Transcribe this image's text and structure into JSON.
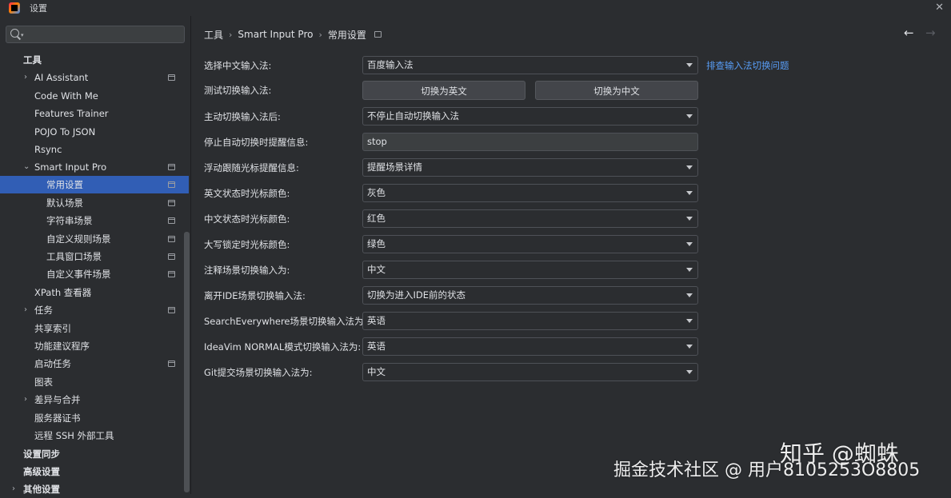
{
  "window": {
    "title": "设置"
  },
  "search": {
    "placeholder": ""
  },
  "sidebar": {
    "items": [
      {
        "label": "工具",
        "bold": true
      },
      {
        "label": "AI Assistant",
        "expandable": true,
        "pinned": true
      },
      {
        "label": "Code With Me"
      },
      {
        "label": "Features Trainer"
      },
      {
        "label": "POJO To JSON"
      },
      {
        "label": "Rsync"
      },
      {
        "label": "Smart Input Pro",
        "expanded": true,
        "pinned": true
      },
      {
        "label": "常用设置",
        "selected": true,
        "pinned": true
      },
      {
        "label": "默认场景",
        "pinned": true
      },
      {
        "label": "字符串场景",
        "pinned": true
      },
      {
        "label": "自定义规则场景",
        "pinned": true
      },
      {
        "label": "工具窗口场景",
        "pinned": true
      },
      {
        "label": "自定义事件场景",
        "pinned": true
      },
      {
        "label": "XPath 查看器"
      },
      {
        "label": "任务",
        "expandable": true,
        "pinned": true
      },
      {
        "label": "共享索引"
      },
      {
        "label": "功能建议程序"
      },
      {
        "label": "启动任务",
        "pinned": true
      },
      {
        "label": "图表"
      },
      {
        "label": "差异与合并",
        "expandable": true
      },
      {
        "label": "服务器证书"
      },
      {
        "label": "远程 SSH 外部工具"
      },
      {
        "label": "设置同步",
        "bold": true
      },
      {
        "label": "高级设置",
        "bold": true
      },
      {
        "label": "其他设置",
        "bold": true,
        "expandable": true
      }
    ]
  },
  "breadcrumb": {
    "part1": "工具",
    "part2": "Smart Input Pro",
    "part3": "常用设置"
  },
  "form": {
    "input_method": {
      "label": "选择中文输入法:",
      "value": "百度输入法",
      "link": "排查输入法切换问题"
    },
    "test_switch": {
      "label": "测试切换输入法:",
      "btn_en": "切换为英文",
      "btn_cn": "切换为中文"
    },
    "after_manual": {
      "label": "主动切换输入法后:",
      "value": "不停止自动切换输入法"
    },
    "stop_hint": {
      "label": "停止自动切换时提醒信息:",
      "value": "stop"
    },
    "float_hint": {
      "label": "浮动跟随光标提醒信息:",
      "value": "提醒场景详情"
    },
    "en_cursor": {
      "label": "英文状态时光标颜色:",
      "value": "灰色"
    },
    "cn_cursor": {
      "label": "中文状态时光标颜色:",
      "value": "红色"
    },
    "caps_cursor": {
      "label": "大写锁定时光标颜色:",
      "value": "绿色"
    },
    "comment_scene": {
      "label": "注释场景切换输入为:",
      "value": "中文"
    },
    "leave_ide": {
      "label": "离开IDE场景切换输入法:",
      "value": "切换为进入IDE前的状态"
    },
    "search_everywhere": {
      "label": "SearchEverywhere场景切换输入法为:",
      "value": "英语"
    },
    "ideavim": {
      "label": "IdeaVim NORMAL模式切换输入法为:",
      "value": "英语"
    },
    "git_commit": {
      "label": "Git提交场景切换输入法为:",
      "value": "中文"
    }
  },
  "watermark": {
    "line1": "知乎 @蜘蛛",
    "line2": "掘金技术社区 @ 用户8105253O8805"
  }
}
